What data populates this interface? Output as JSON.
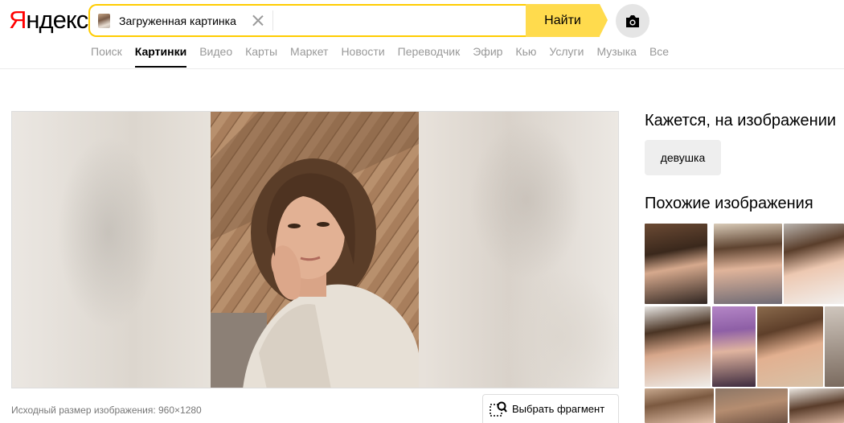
{
  "logo": {
    "first_letter": "Я",
    "rest": "ндекс"
  },
  "search": {
    "chip_label": "Загруженная картинка",
    "input_value": "",
    "find_label": "Найти"
  },
  "nav": [
    {
      "label": "Поиск",
      "active": false
    },
    {
      "label": "Картинки",
      "active": true
    },
    {
      "label": "Видео",
      "active": false
    },
    {
      "label": "Карты",
      "active": false
    },
    {
      "label": "Маркет",
      "active": false
    },
    {
      "label": "Новости",
      "active": false
    },
    {
      "label": "Переводчик",
      "active": false
    },
    {
      "label": "Эфир",
      "active": false
    },
    {
      "label": "Кью",
      "active": false
    },
    {
      "label": "Услуги",
      "active": false
    },
    {
      "label": "Музыка",
      "active": false
    },
    {
      "label": "Все",
      "active": false
    }
  ],
  "viewer": {
    "original_size": "Исходный размер изображения: 960×1280",
    "fragment_label": "Выбрать фрагмент"
  },
  "sidebar": {
    "seems_title": "Кажется, на изображении",
    "tag": "девушка",
    "similar_title": "Похожие изображения"
  },
  "colors": {
    "accent": "#ffdb4d",
    "search_border": "#ffcc00",
    "logo_red": "#ff0000",
    "nav_inactive": "#999999"
  }
}
